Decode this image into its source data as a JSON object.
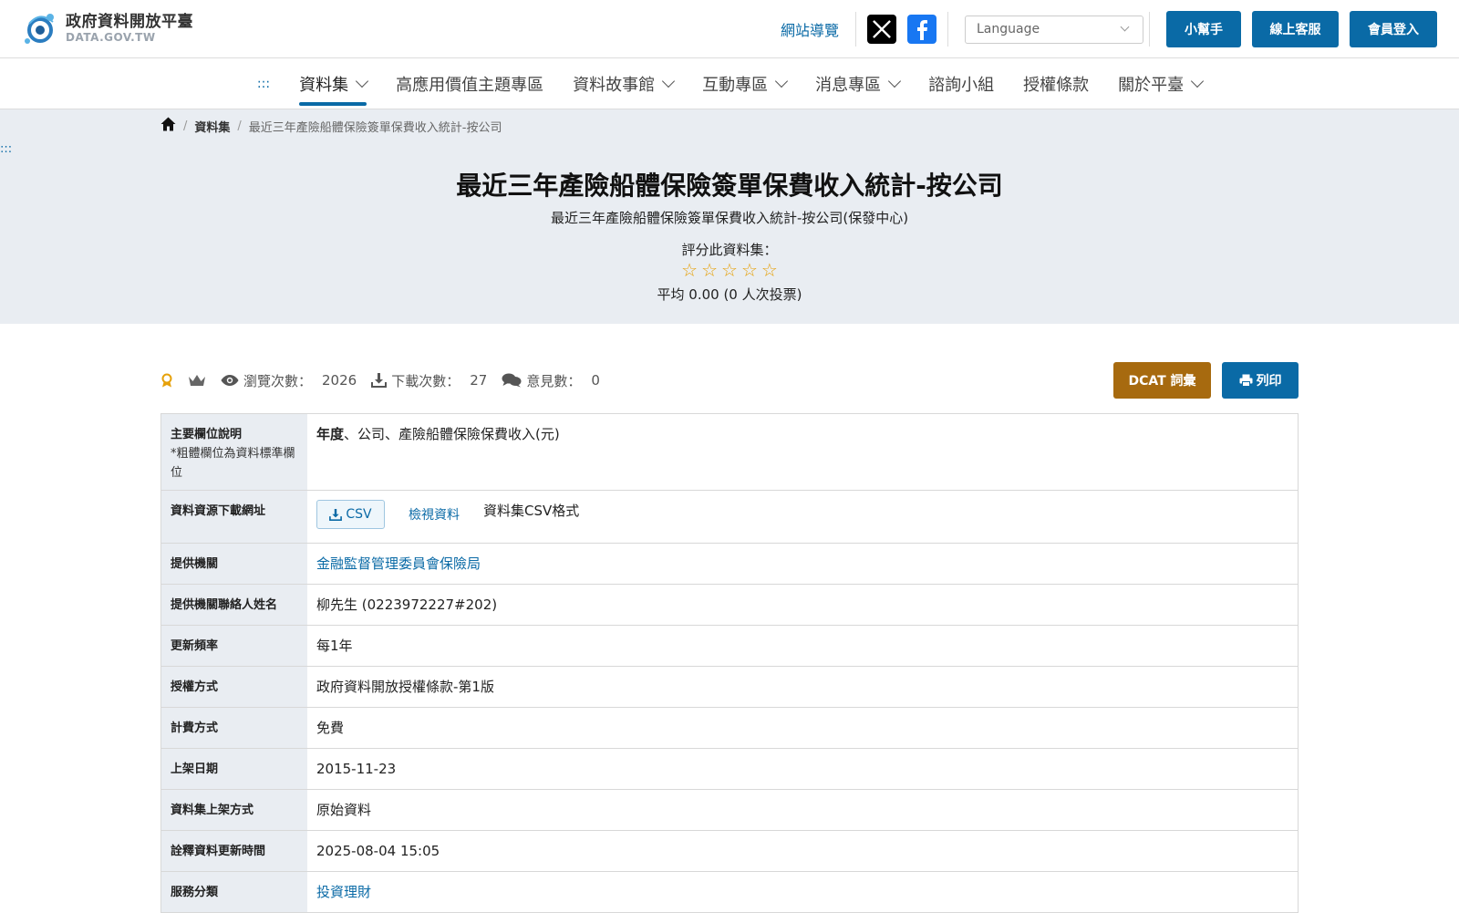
{
  "header": {
    "logo_title": "政府資料開放平臺",
    "logo_sub": "DATA.GOV.TW",
    "sitemap": "網站導覽",
    "language_placeholder": "Language",
    "help": "小幫手",
    "service": "線上客服",
    "login": "會員登入"
  },
  "nav": {
    "accesskey": ":::",
    "items": [
      {
        "label": "資料集"
      },
      {
        "label": "高應用價值主題專區"
      },
      {
        "label": "資料故事館"
      },
      {
        "label": "互動專區"
      },
      {
        "label": "消息專區"
      },
      {
        "label": "諮詢小組"
      },
      {
        "label": "授權條款"
      },
      {
        "label": "關於平臺"
      }
    ]
  },
  "breadcrumb": {
    "home": "首頁",
    "datasets": "資料集",
    "current": "最近三年產險船體保險簽單保費收入統計-按公司"
  },
  "side_accesskey": ":::",
  "dataset": {
    "title": "最近三年產險船體保險簽單保費收入統計-按公司",
    "subtitle": "最近三年產險船體保險簽單保費收入統計-按公司(保發中心)",
    "rate_label": "評分此資料集：",
    "rating_value": 0,
    "rating_max": 5,
    "average": "平均 0.00 (0 人次投票)"
  },
  "stats": {
    "views_label": "瀏覽次數：",
    "views": "2026",
    "downloads_label": "下載次數：",
    "downloads": "27",
    "comments_label": "意見數：",
    "comments": "0",
    "dcat": "DCAT 詞彙",
    "print": "列印"
  },
  "table": {
    "fields_header": "主要欄位說明",
    "fields_note": "*粗體欄位為資料標準欄位",
    "fields_bold": "年度",
    "fields_rest": "、公司、產險船體保險保費收入(元)",
    "resource_header": "資料資源下載網址",
    "csv_label": "CSV",
    "view_label": "檢視資料",
    "resource_desc": "資料集CSV格式",
    "provider_header": "提供機關",
    "provider": "金融監督管理委員會保險局",
    "contact_header": "提供機關聯絡人姓名",
    "contact": "柳先生 (0223972227#202)",
    "frequency_header": "更新頻率",
    "frequency": "每1年",
    "license_header": "授權方式",
    "license": "政府資料開放授權條款-第1版",
    "fee_header": "計費方式",
    "fee": "免費",
    "publish_header": "上架日期",
    "publish": "2015-11-23",
    "method_header": "資料集上架方式",
    "method": "原始資料",
    "meta_header": "詮釋資料更新時間",
    "meta": "2025-08-04 15:05",
    "category_header": "服務分類",
    "category": "投資理財"
  }
}
